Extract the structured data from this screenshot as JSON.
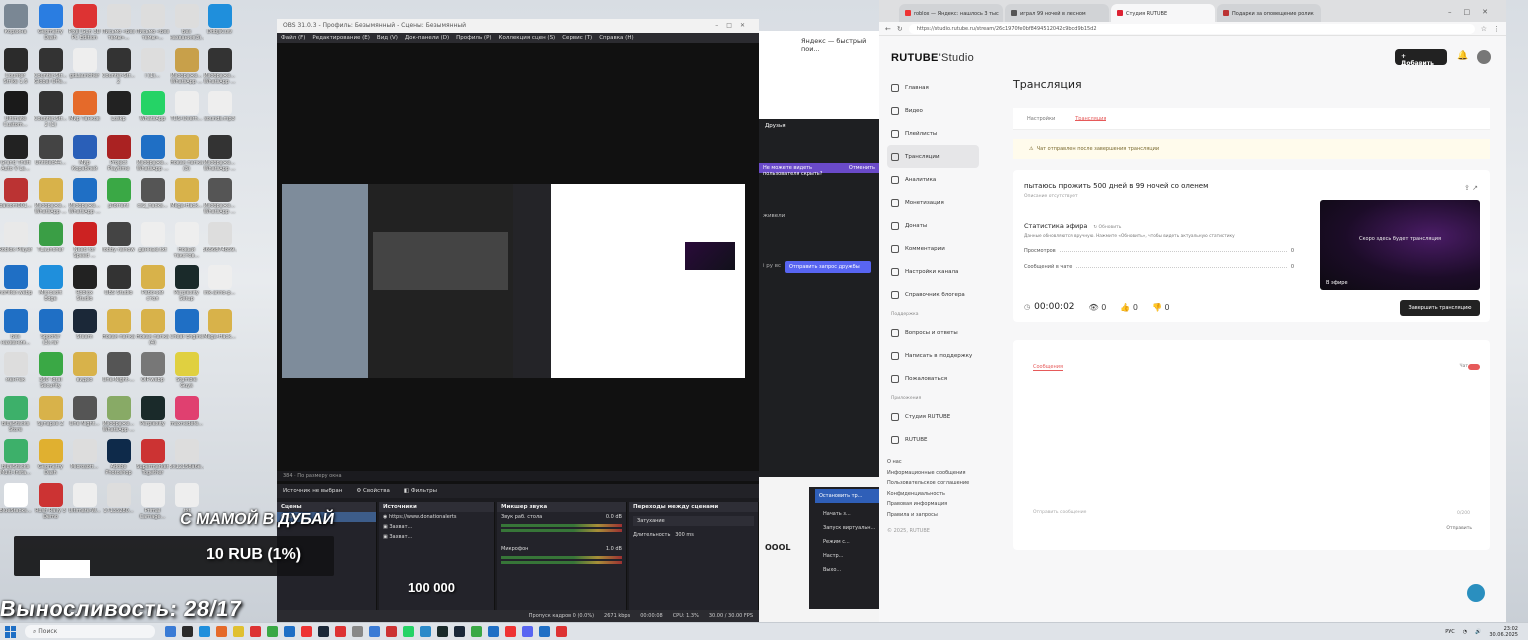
{
  "desktop": {
    "icons": [
      {
        "label": "Корзина",
        "color": "#7a8794"
      },
      {
        "label": "Counter Strike 1.6",
        "color": "#2b2b2b"
      },
      {
        "label": "Ultimate Custom...",
        "color": "#1a1a1a"
      },
      {
        "label": "Grand Theft Auto V Le...",
        "color": "#222"
      },
      {
        "label": "balcom001...",
        "color": "#b33"
      },
      {
        "label": "Roblox Player",
        "color": "#e9e9e9"
      },
      {
        "label": "noFilter.webp",
        "color": "#1f6fc5"
      },
      {
        "label": "Без названия...",
        "color": "#1f6fc5"
      },
      {
        "label": "ментек",
        "color": "#ddd"
      },
      {
        "label": "BlueStacks Store",
        "color": "#3db06a"
      },
      {
        "label": "BlueStacks Multi-Insta...",
        "color": "#3db06a"
      },
      {
        "label": "BlueStacks...",
        "color": "#ffffff"
      },
      {
        "label": "Geometry Dash",
        "color": "#2a7de1"
      },
      {
        "label": "Counter-Str... Global Offe...",
        "color": "#333"
      },
      {
        "label": "Counter-Str... 2 (1)",
        "color": "#333"
      },
      {
        "label": "Untitled44...",
        "color": "#444"
      },
      {
        "label": "Изображе... WhatsApp ...",
        "color": "#d8b24a"
      },
      {
        "label": "TLauncher",
        "color": "#3a9e45"
      },
      {
        "label": "Microsoft Edge",
        "color": "#1f8fdc"
      },
      {
        "label": "Spoofer (3).rar",
        "color": "#1f6fc5"
      },
      {
        "label": "360 Total Security",
        "color": "#3aa845"
      },
      {
        "label": "Synapse Z",
        "color": "#d8b24a"
      },
      {
        "label": "Geometry Dash",
        "color": "#e0b030"
      },
      {
        "label": "Rush Rally 3 Demo",
        "color": "#c33"
      },
      {
        "label": "Pixel Gun 3D PC Edition",
        "color": "#d33"
      },
      {
        "label": "gdLauncher",
        "color": "#eee"
      },
      {
        "label": "Мир Танков",
        "color": "#e56a2a"
      },
      {
        "label": "Мир Кораблей",
        "color": "#2a5fb8"
      },
      {
        "label": "Изображе... WhatsApp ...",
        "color": "#1f6fc5"
      },
      {
        "label": "Need for Speed ...",
        "color": "#c22"
      },
      {
        "label": "Roblox Studio",
        "color": "#222"
      },
      {
        "label": "Steam",
        "color": "#1b2838"
      },
      {
        "label": "видео",
        "color": "#d8b24a"
      },
      {
        "label": "One Night...",
        "color": "#555"
      },
      {
        "label": "Microsoft...",
        "color": "#ddd"
      },
      {
        "label": "Ultimate-W...",
        "color": "#eee"
      },
      {
        "label": "Письмо «Без темы»...",
        "color": "#ddd"
      },
      {
        "label": "Counter-Str... 2",
        "color": "#333"
      },
      {
        "label": "Loskp",
        "color": "#222"
      },
      {
        "label": "Project Playtime",
        "color": "#a22"
      },
      {
        "label": "µTorrent",
        "color": "#3aa845"
      },
      {
        "label": "lobby rainow",
        "color": "#444"
      },
      {
        "label": "OBS Studio",
        "color": "#333"
      },
      {
        "label": "Новая папка",
        "color": "#d8b24a"
      },
      {
        "label": "One-Night-...",
        "color": "#555"
      },
      {
        "label": "Изображе... WhatsApp ...",
        "color": "#8a6"
      },
      {
        "label": "Adobe Photoshop",
        "color": "#0e2a4a"
      },
      {
        "label": "17135280...",
        "color": "#ddd"
      },
      {
        "label": "Письмо «Без темы»...",
        "color": "#ddd"
      },
      {
        "label": "i (1)...",
        "color": "#ddd"
      },
      {
        "label": "WhatsApp",
        "color": "#25d366"
      },
      {
        "label": "Изображе... WhatsApp ...",
        "color": "#1f6fc5"
      },
      {
        "label": "cs2_hacks...",
        "color": "#555"
      },
      {
        "label": "данные.txt",
        "color": "#eee"
      },
      {
        "label": "Рабочий стол",
        "color": "#d8b24a"
      },
      {
        "label": "Новая папка (4)",
        "color": "#d8b24a"
      },
      {
        "label": "OIP.webp",
        "color": "#777"
      },
      {
        "label": "Perplexity",
        "color": "#1a2a2a"
      },
      {
        "label": "Supermarket Together",
        "color": "#c33"
      },
      {
        "label": "Primal Carnage...",
        "color": "#eee"
      },
      {
        "label": "Без названия(3)...",
        "color": "#ddd"
      },
      {
        "label": "Изображе... WhatsApp ...",
        "color": "#c8a04a"
      },
      {
        "label": "TDS-Overh...",
        "color": "#eee"
      },
      {
        "label": "Новая папка (3)",
        "color": "#d8b24a"
      },
      {
        "label": "Mega-Hack...",
        "color": "#d8b24a"
      },
      {
        "label": "Новый текстов...",
        "color": "#eee"
      },
      {
        "label": "Perplexity Setup",
        "color": "#1a2a2a"
      },
      {
        "label": "Cheat Engine",
        "color": "#1f6fc5"
      },
      {
        "label": "Stumble Guys",
        "color": "#e0d040"
      },
      {
        "label": "maxnedefe...",
        "color": "#e04070"
      },
      {
        "label": "5x12158a6e...",
        "color": "#ddd"
      },
      {
        "label": ".txt",
        "color": "#eee"
      },
      {
        "label": "DdbjsCuw",
        "color": "#1f8fdc"
      },
      {
        "label": "Изображе... WhatsApp ...",
        "color": "#333"
      },
      {
        "label": "sounds.mp3",
        "color": "#eee"
      },
      {
        "label": "Изображе... WhatsApp ...",
        "color": "#333"
      },
      {
        "label": "Изображе... WhatsApp ...",
        "color": "#555"
      },
      {
        "label": "5656874859...",
        "color": "#ddd"
      },
      {
        "label": "ink-anno-p...",
        "color": "#eee"
      },
      {
        "label": "Mega-Hack...",
        "color": "#d8b24a"
      }
    ]
  },
  "obs": {
    "title": "OBS 31.0.3 - Профиль: Безымянный - Сцены: Безымянный",
    "menu": [
      "Файл (F)",
      "Редактирование (E)",
      "Вид (V)",
      "Док-панели (D)",
      "Профиль (P)",
      "Коллекция сцен (S)",
      "Сервис (T)",
      "Справка (H)"
    ],
    "preview_caption": "Выносливость: 28/17",
    "preview_rub": "10 RUB (1%)",
    "preview_100k": "100 000",
    "size_label": "384 · По размеру окна",
    "source_status": "Источник не выбран",
    "props_button": "Свойства",
    "filters_button": "Фильтры",
    "docks": {
      "scenes": {
        "title": "Сцены",
        "items": [
          "Сцена"
        ]
      },
      "sources": {
        "title": "Источники",
        "items": [
          "https://www.donationalerts",
          "Захват...",
          "Захват..."
        ]
      },
      "mixer": {
        "title": "Микшер звука",
        "channels": [
          {
            "name": "Звук раб. стола",
            "db": "0.0 dB"
          },
          {
            "name": "Микрофон",
            "db": "1.0 dB"
          }
        ]
      },
      "transitions": {
        "title": "Переходы между сценами",
        "type": "Затухание",
        "duration_label": "Длительность",
        "duration": "300 ms"
      }
    },
    "status": {
      "dropped": "Пропуск кадров 0 (0.0%)",
      "bitrate": "2671 kbps",
      "time": "00:00:08",
      "cpu": "CPU: 1.3%",
      "fps": "30.00 / 30.00 FPS"
    }
  },
  "yandex": {
    "text": "Яндекс — быстрый пои..."
  },
  "discord": {
    "header": "Друзья",
    "bar_text": "Не можете видеть пользователя скрыть?",
    "bar_button": "Отменить",
    "side_text": "живели",
    "button": "Отправить запрос дружбы",
    "small": "i ру вс"
  },
  "other_window": {
    "button": "Остановить тр...",
    "items": [
      "Начать з...",
      "Запуск виртуальн...",
      "Режим с...",
      "Настр...",
      "Выхо..."
    ],
    "logo": "OOOL"
  },
  "browser": {
    "tabs": [
      {
        "title": "roblox — Яндекс: нашлось 3 тыс",
        "color": "#e33"
      },
      {
        "title": "играл 99 ночей в лесном",
        "color": "#555"
      },
      {
        "title": "Студия RUTUBE",
        "color": "#d23"
      },
      {
        "title": "Подарки за оповещение ролик",
        "color": "#b33"
      }
    ],
    "url": "https://studio.rutube.ru/stream/26c1970fe0bf8494512042c9bcd9b15d2"
  },
  "rutube": {
    "logo": "RUTUBE",
    "logo_suffix": "Studio",
    "add_button": "Добавить",
    "nav": [
      "Главная",
      "Видео",
      "Плейлисты",
      "Трансляции",
      "Аналитика",
      "Монетизация",
      "Донаты",
      "Комментарии",
      "Настройки канала",
      "Справочник блогера"
    ],
    "support_title": "Поддержка",
    "support": [
      "Вопросы и ответы",
      "Написать в поддержку",
      "Пожаловаться"
    ],
    "apps_title": "Приложения",
    "apps": [
      "Студия RUTUBE",
      "RUTUBE"
    ],
    "footer": [
      "О нас",
      "Информационные сообщения",
      "Пользовательское соглашение",
      "Конфиденциальность",
      "Правовая информация",
      "Правила и запросы"
    ],
    "copyright": "© 2025, RUTUBE",
    "page_title": "Трансляция",
    "tabs": [
      "Настройки",
      "Трансляция"
    ],
    "warning": "Чат отправлен после завершения трансляции",
    "stream_title": "пытаюсь прожить 500 дней в 99 ночей со оленем",
    "stream_sub": "Описание отсутствует",
    "stats_title": "Статистика эфира",
    "stats_update": "Обновить",
    "stats_desc": "Данные обновляются вручную. Нажмите «Обновить», чтобы видеть актуальную статистику",
    "views_label": "Просмотров",
    "views": "0",
    "chat_msgs_label": "Сообщений в чате",
    "chat_msgs": "0",
    "timer": "00:00:02",
    "viewers": "0",
    "likes": "0",
    "dislikes": "0",
    "preview_text": "Скоро здесь будет трансляция",
    "live_label": "В эфире",
    "end_button": "Завершить трансляцию",
    "chat_tab": "Сообщения",
    "chat_toggle": "Чат",
    "chat_input": "Отправить сообщение",
    "chat_counter": "0/200",
    "chat_send": "Отправить"
  },
  "taskbar": {
    "search": "Поиск",
    "apps": [
      "#3a7bd5",
      "#2b2b2b",
      "#1f8fdc",
      "#e56a2a",
      "#e0c030",
      "#d33",
      "#3aa845",
      "#1f6fc5",
      "#e33",
      "#1b2838",
      "#d33",
      "#888",
      "#3a7bd5",
      "#c33",
      "#25d366",
      "#2b8ac9",
      "#1a2a2a",
      "#1b2838",
      "#3aa845",
      "#1f6fc5",
      "#e33",
      "#5865f2",
      "#1f6fc5",
      "#d33"
    ],
    "lang": "РУС",
    "time": "23:02",
    "date": "30.06.2025"
  }
}
